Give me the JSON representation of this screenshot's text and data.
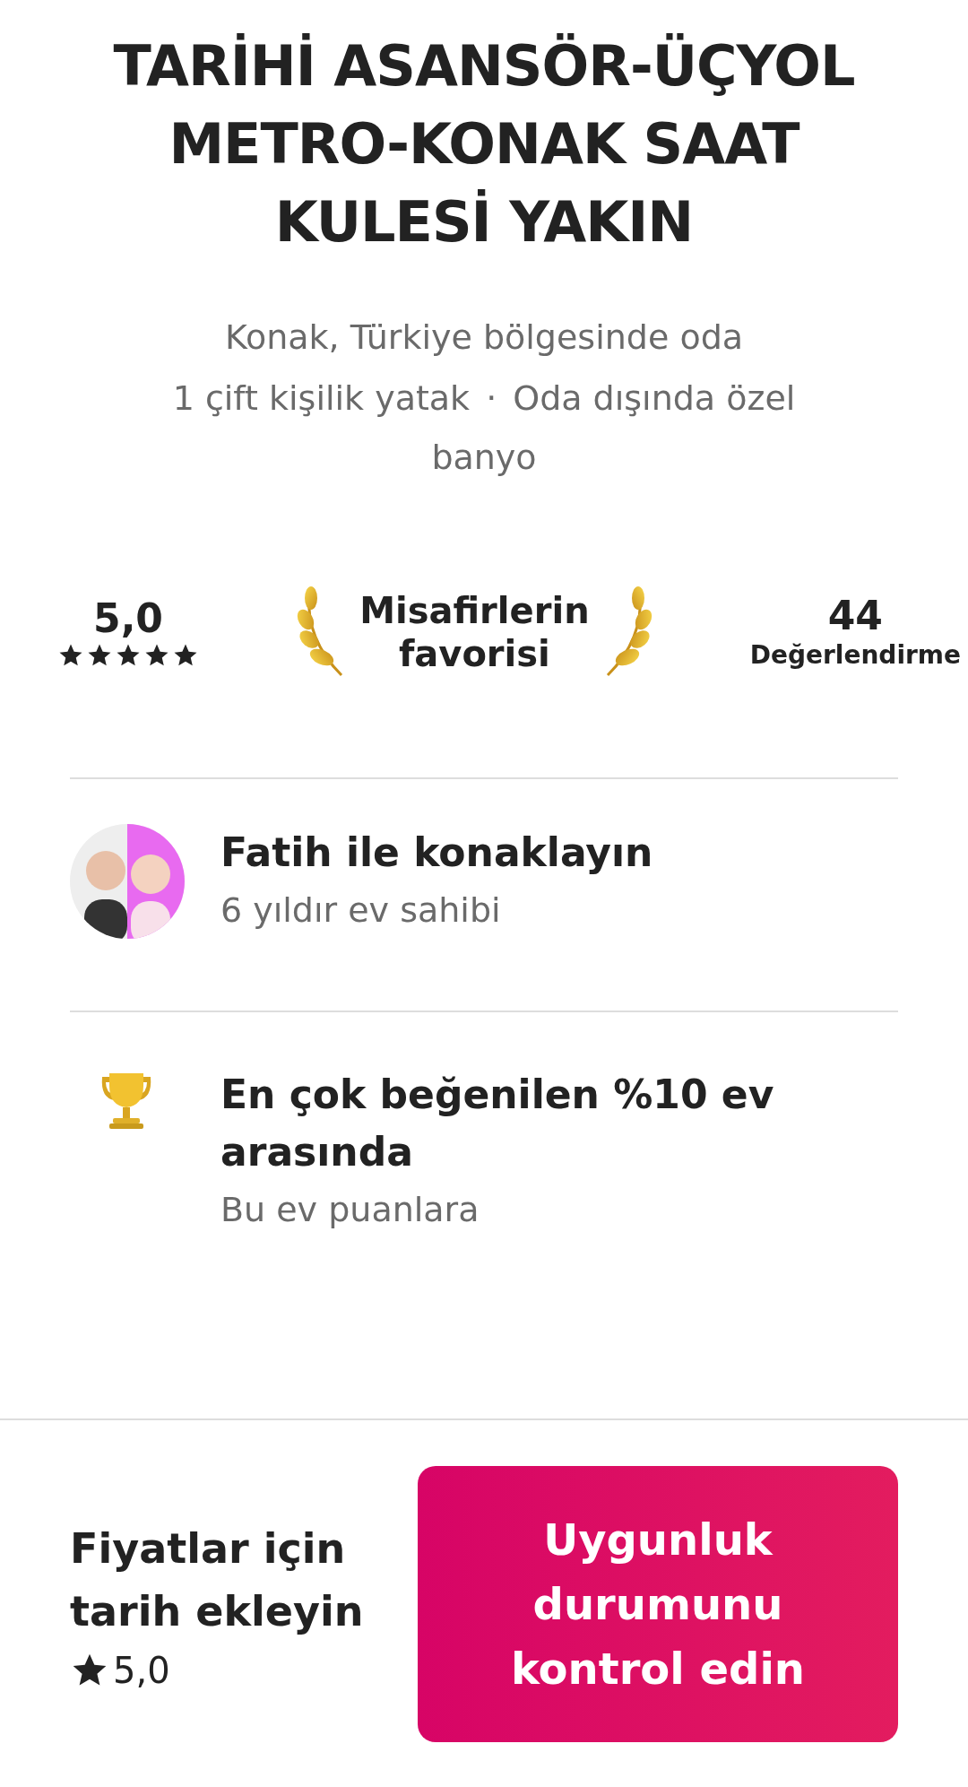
{
  "title": "TARİHİ ASANSÖR-ÜÇYOL METRO-KONAK SAAT KULESİ YAKIN",
  "location": "Konak, Türkiye bölgesinde oda",
  "details": [
    "1 çift kişilik yatak",
    "Oda dışında özel banyo"
  ],
  "separator": "·",
  "rating": {
    "value": "5,0",
    "stars": 5
  },
  "badge": {
    "line_1": "Misafirlerin",
    "line_2": "favorisi"
  },
  "reviews": {
    "count": "44",
    "label": "Değerlendirme"
  },
  "host": {
    "title": "Fatih ile konaklayın",
    "subtitle": "6 yıldır ev sahibi"
  },
  "highlight": {
    "title": "En çok beğenilen %10 ev arasında",
    "text": "Bu ev puanlara"
  },
  "footer": {
    "prompt": "Fiyatlar için tarih ekleyin",
    "rating": "5,0",
    "button": "Uygunluk durumunu kontrol edin"
  }
}
